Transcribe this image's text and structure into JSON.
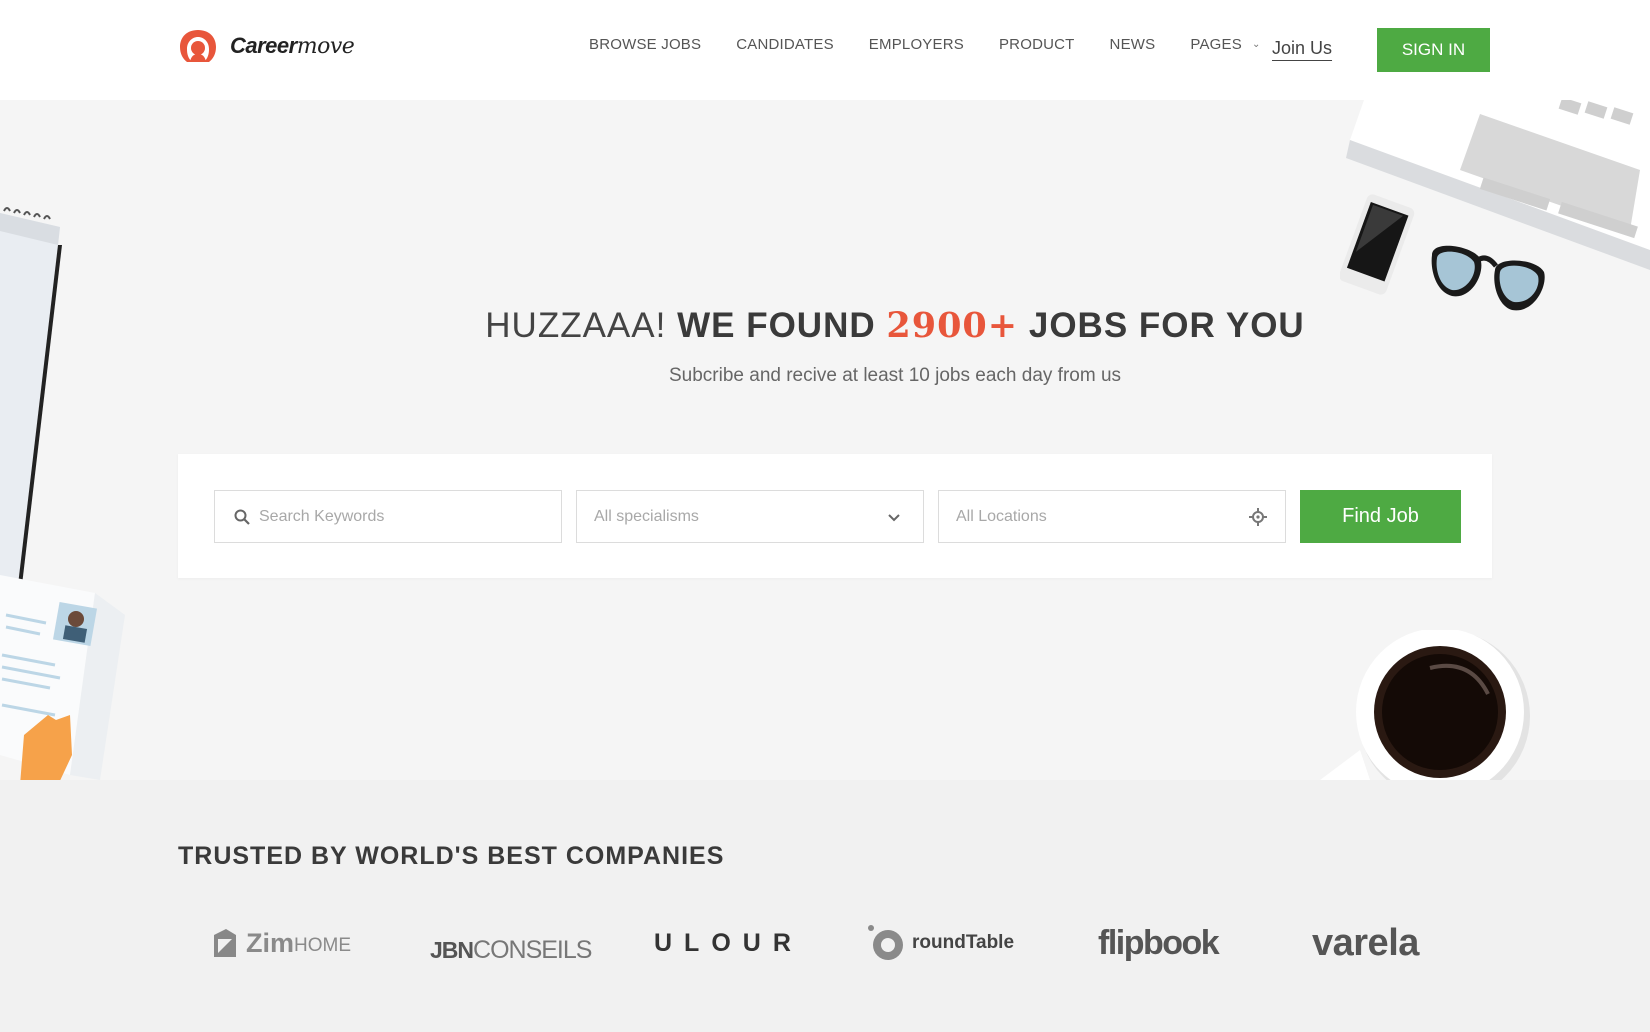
{
  "brand": {
    "name_bold": "Career",
    "name_script": "move"
  },
  "nav": {
    "items": [
      "BROWSE JOBS",
      "CANDIDATES",
      "EMPLOYERS",
      "PRODUCT",
      "NEWS",
      "PAGES"
    ],
    "join_label": "Join Us",
    "signin_label": "SIGN IN"
  },
  "hero": {
    "title_light": "HUZZAAA!",
    "title_bold_1": "WE FOUND",
    "title_count": "2900+",
    "title_bold_2": "JOBS FOR YOU",
    "subtitle": "Subcribe and recive at least 10 jobs each day from us"
  },
  "search": {
    "keywords_placeholder": "Search Keywords",
    "specialism_value": "All specialisms",
    "location_placeholder": "All Locations",
    "button_label": "Find Job"
  },
  "companies": {
    "title": "TRUSTED BY WORLD'S BEST COMPANIES",
    "logos": [
      {
        "name": "Zim",
        "suffix": "HOME"
      },
      {
        "name": "JBN",
        "suffix": "CONSEILS"
      },
      {
        "name": "ULOUR",
        "suffix": ""
      },
      {
        "name": "roundTable",
        "suffix": ""
      },
      {
        "name": "flipbook",
        "suffix": ""
      },
      {
        "name": "varela",
        "suffix": ""
      }
    ]
  },
  "colors": {
    "accent_green": "#4eaa43",
    "accent_orange": "#e8563b",
    "hero_bg": "#f5f5f5",
    "companies_bg": "#f1f1f1"
  },
  "icons": [
    "logo-mark-icon",
    "search-icon",
    "chevron-down-icon",
    "locate-icon"
  ]
}
